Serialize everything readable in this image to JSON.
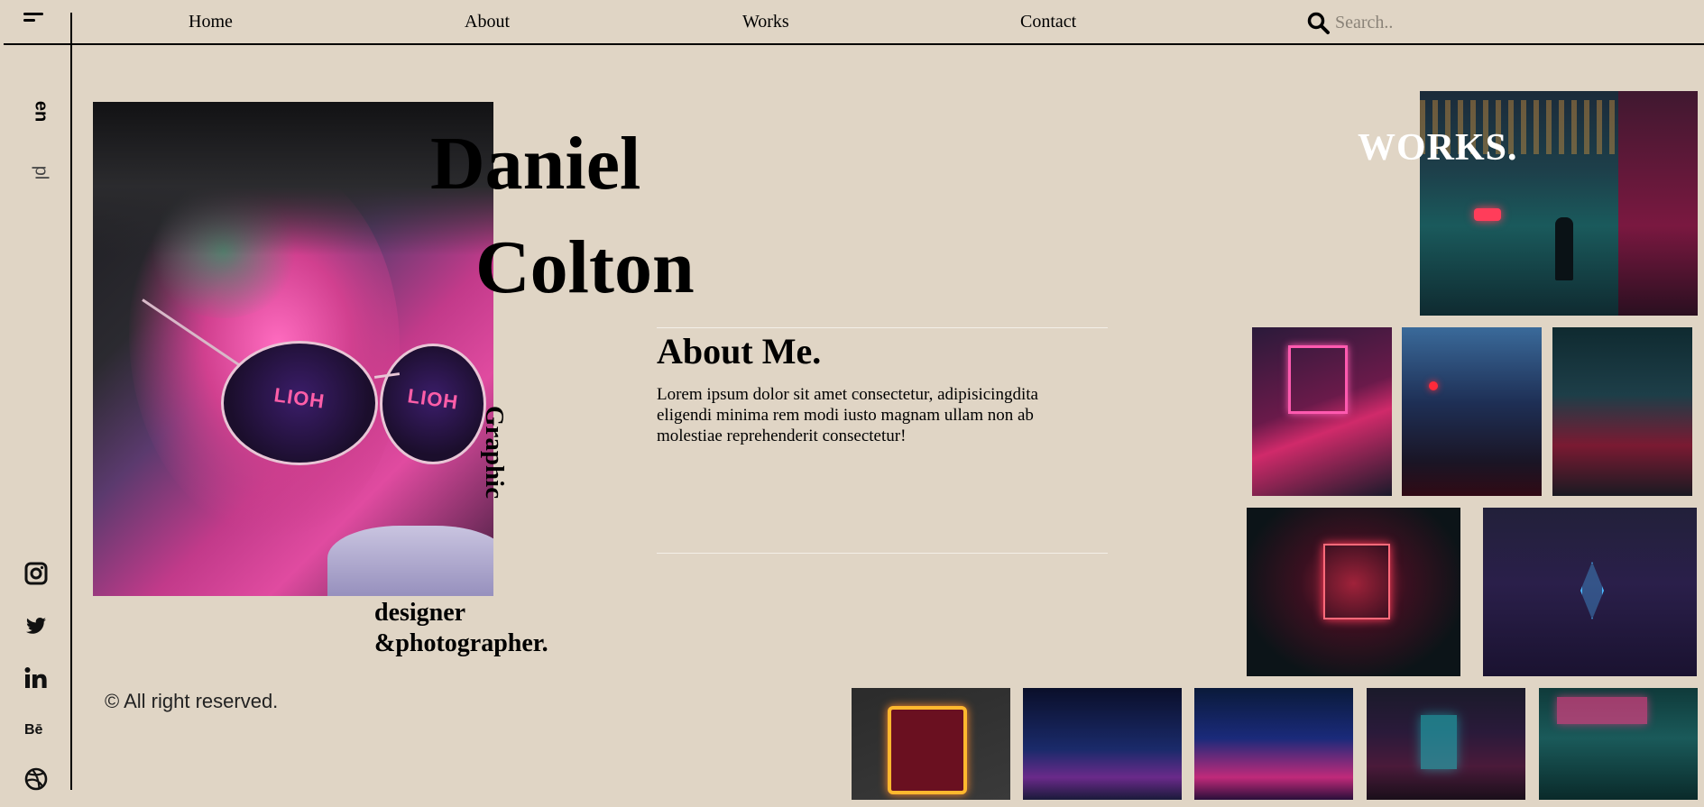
{
  "nav": {
    "items": [
      "Home",
      "About",
      "Works",
      "Contact"
    ],
    "search_placeholder": "Search.."
  },
  "language": {
    "primary": "en",
    "secondary": "pl"
  },
  "social": [
    "instagram-icon",
    "twitter-icon",
    "linkedin-icon",
    "behance-icon",
    "dribbble-icon"
  ],
  "hero": {
    "first_name": "Daniel",
    "last_name": "Colton",
    "role_vertical": "Graphic",
    "role_line1": "designer",
    "role_line2": "&photographer."
  },
  "about": {
    "title": "About Me.",
    "text": "Lorem ipsum dolor sit amet consectetur, adipisicingdita eligendi minima rem modi iusto magnam ullam non ab molestiae reprehenderit consectetur!"
  },
  "works": {
    "title": "WORKS.",
    "portrait_lens_text": "LIOH"
  },
  "footer": {
    "copyright": "© All right reserved."
  },
  "colors": {
    "background": "#e0d5c5",
    "text": "#000000",
    "divider": "#f4efe8",
    "neon_pink": "#ff3d8b",
    "neon_cyan": "#19c7d6"
  }
}
